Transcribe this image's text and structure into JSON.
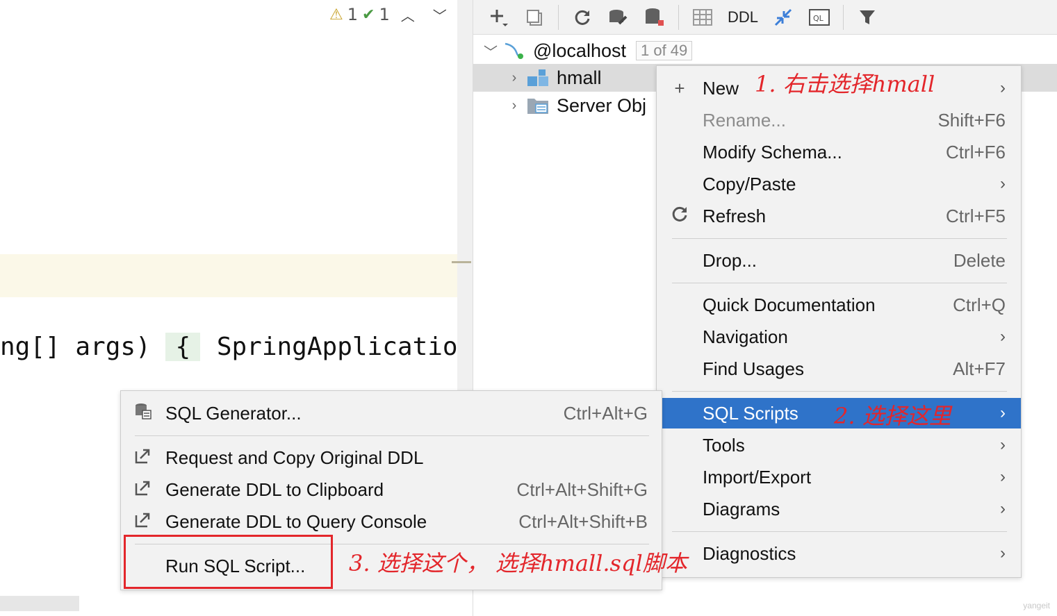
{
  "editor": {
    "inspections": {
      "warning_count": "1",
      "ok_count": "1"
    },
    "code_left": "ng[] args)",
    "code_brace": "{",
    "code_right": "SpringApplication."
  },
  "db_panel": {
    "toolbar": {
      "ddl_label": "DDL"
    },
    "tree": {
      "connection": "@localhost",
      "connection_count": "1 of 49",
      "schema": "hmall",
      "server_objects": "Server Obj"
    }
  },
  "main_menu": {
    "items": [
      {
        "label": "New",
        "shortcut": "",
        "arrow": true
      },
      {
        "label": "Rename...",
        "shortcut": "Shift+F6",
        "arrow": false
      },
      {
        "label": "Modify Schema...",
        "shortcut": "Ctrl+F6",
        "arrow": false
      },
      {
        "label": "Copy/Paste",
        "shortcut": "",
        "arrow": true
      },
      {
        "label": "Refresh",
        "shortcut": "Ctrl+F5",
        "arrow": false
      },
      {
        "label": "Drop...",
        "shortcut": "Delete",
        "arrow": false
      },
      {
        "label": "Quick Documentation",
        "shortcut": "Ctrl+Q",
        "arrow": false
      },
      {
        "label": "Navigation",
        "shortcut": "",
        "arrow": true
      },
      {
        "label": "Find Usages",
        "shortcut": "Alt+F7",
        "arrow": false
      },
      {
        "label": "SQL Scripts",
        "shortcut": "",
        "arrow": true
      },
      {
        "label": "Tools",
        "shortcut": "",
        "arrow": true
      },
      {
        "label": "Import/Export",
        "shortcut": "",
        "arrow": true
      },
      {
        "label": "Diagrams",
        "shortcut": "",
        "arrow": true
      },
      {
        "label": "Diagnostics",
        "shortcut": "",
        "arrow": true
      }
    ]
  },
  "sub_menu": {
    "items": [
      {
        "label": "SQL Generator...",
        "shortcut": "Ctrl+Alt+G"
      },
      {
        "label": "Request and Copy Original DDL",
        "shortcut": ""
      },
      {
        "label": "Generate DDL to Clipboard",
        "shortcut": "Ctrl+Alt+Shift+G"
      },
      {
        "label": "Generate DDL to Query Console",
        "shortcut": "Ctrl+Alt+Shift+B"
      },
      {
        "label": "Run SQL Script...",
        "shortcut": ""
      }
    ]
  },
  "annotations": {
    "step1": "1. 右击选择hmall",
    "step2": "2. 选择这里",
    "step3": "3. 选择这个， 选择hmall.sql脚本"
  },
  "watermark": "yangeit",
  "colors": {
    "selection": "#2f73c9",
    "annotation": "#e3262b"
  }
}
